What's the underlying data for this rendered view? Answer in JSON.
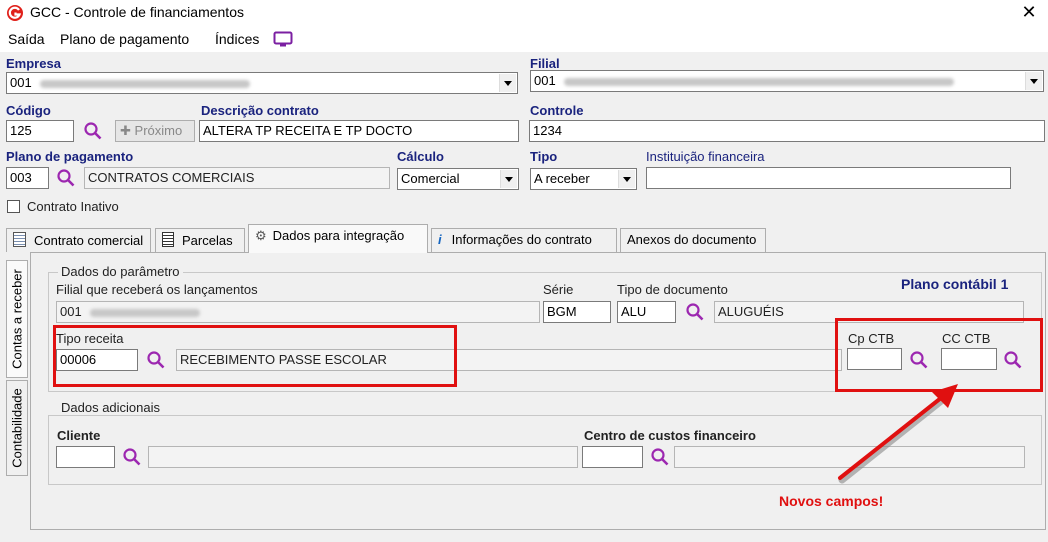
{
  "window": {
    "title": "GCC - Controle de financiamentos",
    "close_glyph": "✕"
  },
  "menu": {
    "items": [
      "Saída",
      "Plano de pagamento",
      "Índices"
    ]
  },
  "header": {
    "empresa": {
      "label": "Empresa",
      "value": "001"
    },
    "filial": {
      "label": "Filial",
      "value": "001"
    },
    "codigo": {
      "label": "Código",
      "value": "125"
    },
    "proximo_label": "Próximo",
    "descricao": {
      "label": "Descrição contrato",
      "value": "ALTERA TP RECEITA E TP DOCTO"
    },
    "controle": {
      "label": "Controle",
      "value": "1234"
    },
    "plano": {
      "label": "Plano de pagamento",
      "code": "003",
      "name": "CONTRATOS COMERCIAIS"
    },
    "calculo": {
      "label": "Cálculo",
      "value": "Comercial"
    },
    "tipo": {
      "label": "Tipo",
      "value": "A receber"
    },
    "instituicao": {
      "label": "Instituição financeira",
      "value": ""
    },
    "inativo_label": "Contrato Inativo",
    "inativo_checked": false
  },
  "tabs": [
    {
      "label": "Contrato comercial",
      "icon": "calculator-icon",
      "active": false
    },
    {
      "label": "Parcelas",
      "icon": "document-icon",
      "active": false
    },
    {
      "label": "Dados para integração",
      "icon": "gears-icon",
      "active": true
    },
    {
      "label": "Informações do contrato",
      "icon": "info-icon",
      "active": false
    },
    {
      "label": "Anexos do documento",
      "icon": "",
      "active": false
    }
  ],
  "side_tabs": [
    "Contas a receber",
    "Contabilidade"
  ],
  "integration": {
    "params_title": "Dados do parâmetro",
    "filial_label": "Filial que receberá os lançamentos",
    "filial_value": "001",
    "serie_label": "Série",
    "serie_value": "BGM",
    "tipo_doc_label": "Tipo de documento",
    "tipo_doc_code": "ALU",
    "tipo_doc_name": "ALUGUÉIS",
    "plano_contabil": "Plano contábil 1",
    "tipo_receita_label": "Tipo receita",
    "tipo_receita_code": "00006",
    "tipo_receita_name": "RECEBIMENTO PASSE ESCOLAR",
    "cp_ctb_label": "Cp CTB",
    "cp_ctb_value": "",
    "cc_ctb_label": "CC CTB",
    "cc_ctb_value": "",
    "adicionais_title": "Dados adicionais",
    "cliente_label": "Cliente",
    "cliente_code": "",
    "cliente_name": "",
    "centro_label": "Centro de custos financeiro",
    "centro_code": "",
    "centro_name": ""
  },
  "annotation": {
    "text": "Novos campos!",
    "color": "#e01010"
  }
}
